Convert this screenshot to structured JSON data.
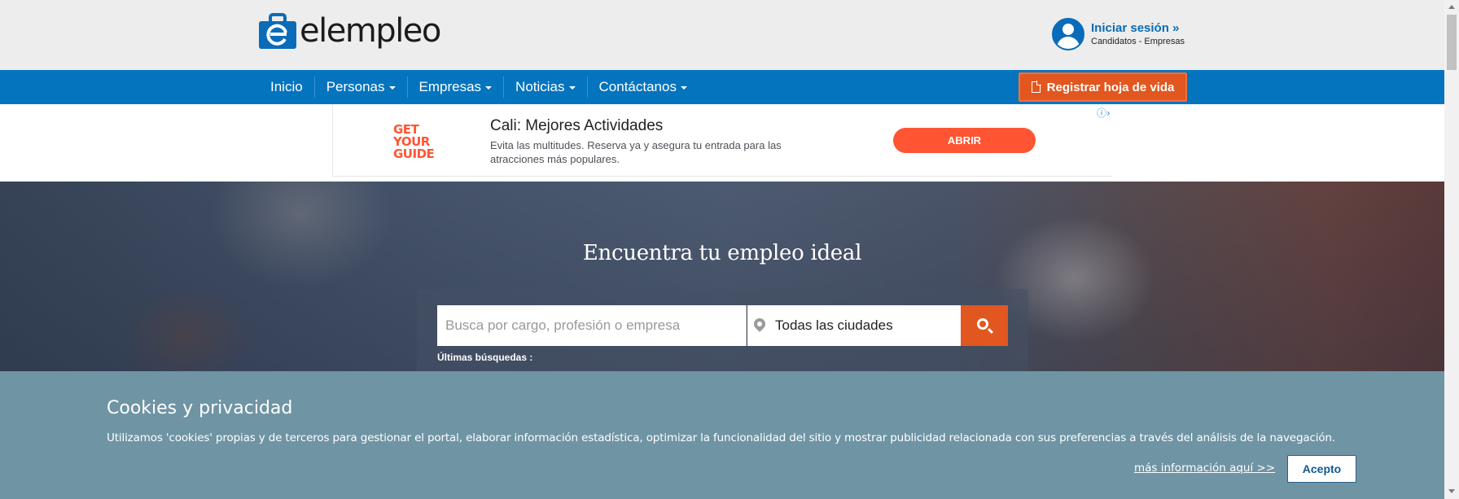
{
  "header": {
    "logo_text": "elempleo",
    "login": {
      "title": "Iniciar sesión »",
      "subtitle": "Candidatos - Empresas"
    }
  },
  "nav": {
    "items": [
      {
        "label": "Inicio",
        "dropdown": false
      },
      {
        "label": "Personas",
        "dropdown": true
      },
      {
        "label": "Empresas",
        "dropdown": true
      },
      {
        "label": "Noticias",
        "dropdown": true
      },
      {
        "label": "Contáctanos",
        "dropdown": true
      }
    ],
    "register_button": "Registrar hoja de vida"
  },
  "ad": {
    "logo_lines": [
      "GET",
      "YOUR",
      "GUIDE"
    ],
    "title": "Cali: Mejores Actividades",
    "description": "Evita las multitudes. Reserva ya y asegura tu entrada para las atracciones más populares.",
    "button": "ABRIR"
  },
  "hero": {
    "title": "Encuentra tu empleo ideal",
    "search_placeholder": "Busca por cargo, profesión o empresa",
    "city_value": "Todas las ciudades",
    "recent_label": "Últimas búsquedas :"
  },
  "cookie": {
    "title": "Cookies y privacidad",
    "text": "Utilizamos 'cookies' propias y de terceros para gestionar el portal, elaborar información estadística, optimizar la funcionalidad del sitio y mostrar publicidad relacionada con sus preferencias a través del análisis de la navegación.",
    "link": "más información aquí >>",
    "accept": "Acepto"
  },
  "colors": {
    "brand_blue": "#0474be",
    "accent_orange": "#e2571f",
    "cookie_bg": "#6f94a4",
    "ad_orange": "#ff5533"
  }
}
